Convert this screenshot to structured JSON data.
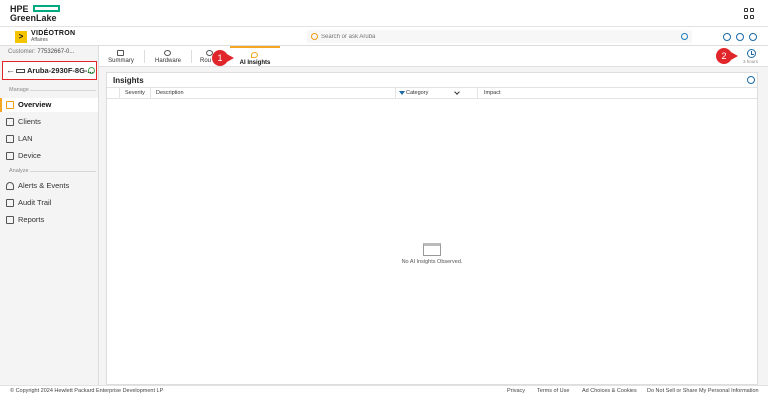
{
  "header": {
    "logo_line1": "HPE",
    "logo_line2": "GreenLake"
  },
  "app_bar": {
    "brand_mark": ">",
    "brand_name": "VIDÉOTRON",
    "brand_sub": "Affaires",
    "search_placeholder": "Search or ask Aruba"
  },
  "sidebar": {
    "customer_label": "Customer:",
    "customer_id": "77532667-0...",
    "device_name": "Aruba-2930F-8G-...",
    "sections": [
      {
        "label": "Manage"
      },
      {
        "label": "Analyze"
      }
    ],
    "manage_items": [
      {
        "label": "Overview",
        "icon": "overview-icon"
      },
      {
        "label": "Clients",
        "icon": "clients-icon"
      },
      {
        "label": "LAN",
        "icon": "lan-icon"
      },
      {
        "label": "Device",
        "icon": "device-icon"
      }
    ],
    "analyze_items": [
      {
        "label": "Alerts & Events",
        "icon": "bell-icon"
      },
      {
        "label": "Audit Trail",
        "icon": "audit-icon"
      },
      {
        "label": "Reports",
        "icon": "reports-icon"
      }
    ]
  },
  "tabs": [
    {
      "label": "Summary"
    },
    {
      "label": "Hardware"
    },
    {
      "label": "Rou"
    },
    {
      "label": "AI Insights"
    }
  ],
  "time_range": {
    "label": "3 hours"
  },
  "insights": {
    "title": "Insights",
    "columns": {
      "severity": "Severity",
      "description": "Description",
      "category": "Category",
      "impact": "Impact"
    },
    "empty_message": "No AI Insights Observed."
  },
  "annotations": {
    "marker1": "1",
    "marker2": "2"
  },
  "footer": {
    "copyright": "© Copyright 2024 Hewlett Packard Enterprise Development LP",
    "links": {
      "privacy": "Privacy",
      "terms": "Terms of Use",
      "ad_choices": "Ad Choices & Cookies",
      "do_not_sell": "Do Not Sell or Share My Personal Information"
    }
  }
}
